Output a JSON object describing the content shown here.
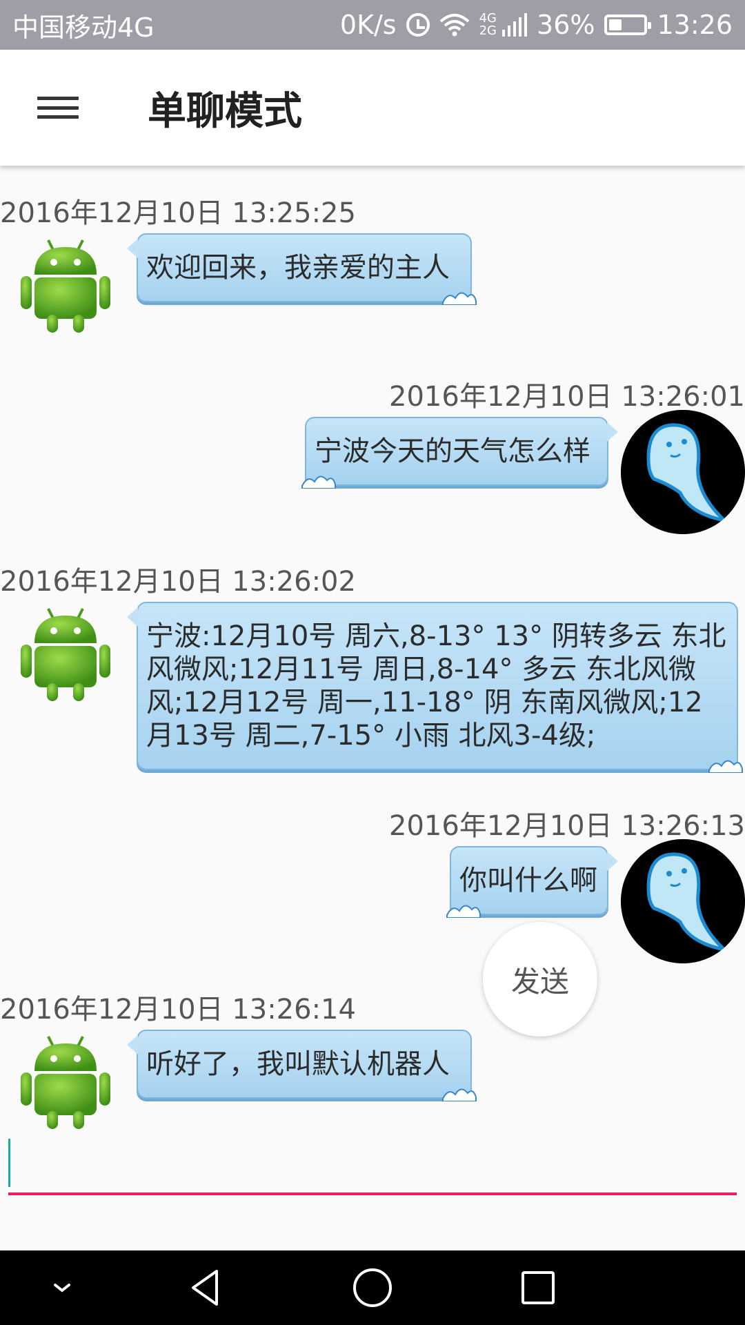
{
  "status_bar": {
    "carrier": "中国移动4G",
    "speed": "0K/s",
    "net_top": "4G",
    "net_bottom": "2G",
    "battery_percent": "36%",
    "battery_level": 0.36,
    "time": "13:26"
  },
  "app_bar": {
    "title": "单聊模式",
    "menu_icon": "hamburger-menu-icon"
  },
  "messages": [
    {
      "side": "left",
      "time": "2016年12月10日 13:25:25",
      "text": "欢迎回来，我亲爱的主人",
      "avatar": "android-robot-avatar"
    },
    {
      "side": "right",
      "time": "2016年12月10日 13:26:01",
      "text": "宁波今天的天气怎么样",
      "avatar": "blue-ghost-avatar"
    },
    {
      "side": "left",
      "time": "2016年12月10日 13:26:02",
      "text": "宁波:12月10号 周六,8-13° 13° 阴转多云 东北风微风;12月11号 周日,8-14° 多云 东北风微风;12月12号 周一,11-18° 阴 东南风微风;12月13号 周二,7-15° 小雨 北风3-4级;",
      "avatar": "android-robot-avatar"
    },
    {
      "side": "right",
      "time": "2016年12月10日 13:26:13",
      "text": "你叫什么啊",
      "avatar": "blue-ghost-avatar"
    },
    {
      "side": "left",
      "time": "2016年12月10日 13:26:14",
      "text": "听好了，我叫默认机器人",
      "avatar": "android-robot-avatar"
    }
  ],
  "send_button": {
    "label": "发送"
  },
  "input": {
    "value": "",
    "placeholder": ""
  },
  "colors": {
    "status_bar": "#9e9fa6",
    "bubble": "#b4dbf4",
    "input_underline": "#e91e63",
    "nav_bar": "#000000"
  },
  "nav_bar": {
    "icons": [
      "chevron-down-icon",
      "back-triangle-icon",
      "home-circle-icon",
      "recents-square-icon"
    ]
  }
}
